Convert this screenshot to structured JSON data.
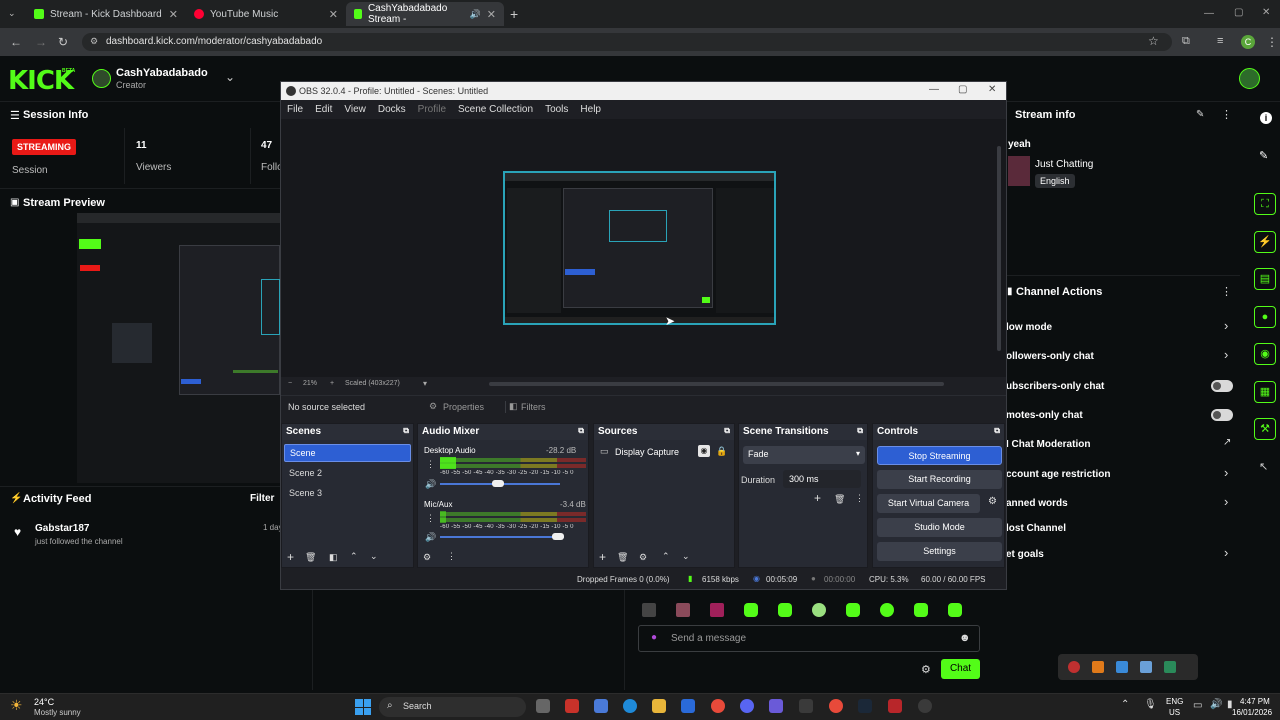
{
  "browser": {
    "tabs": [
      {
        "title": "Stream - Kick Dashboard"
      },
      {
        "title": "YouTube Music"
      },
      {
        "title": "CashYabadabado Stream -"
      }
    ],
    "url": "dashboard.kick.com/moderator/cashyabadabado",
    "profile_initial": "C"
  },
  "kick": {
    "logo": "KICK",
    "logo_tag": "BETA",
    "channel_name": "CashYabadabado",
    "channel_role": "Creator",
    "session_info": {
      "title": "Session Info",
      "status": "STREAMING",
      "status_label": "Session",
      "viewers_value": "11",
      "viewers_label": "Viewers",
      "followers_value": "47",
      "followers_label": "Follo"
    },
    "stream_preview_title": "Stream Preview",
    "activity_feed": {
      "title": "Activity Feed",
      "filter": "Filter",
      "items": [
        {
          "user": "Gabstar187",
          "text": "just followed the channel",
          "time": "1 day"
        }
      ]
    },
    "stream_info": {
      "title": "Stream info",
      "stream_title": "yeah",
      "category": "Just Chatting",
      "language": "English"
    },
    "channel_actions": {
      "title": "Channel Actions",
      "items": [
        {
          "label": "low mode",
          "control": "chevron"
        },
        {
          "label": "ollowers-only chat",
          "control": "chevron"
        },
        {
          "label": "ubscribers-only chat",
          "control": "toggle"
        },
        {
          "label": "motes-only chat",
          "control": "toggle"
        },
        {
          "label": "I Chat Moderation",
          "control": "external"
        },
        {
          "label": "ccount age restriction",
          "control": "chevron"
        },
        {
          "label": "anned words",
          "control": "chevron"
        },
        {
          "label": "lost Channel",
          "control": "none"
        },
        {
          "label": "et goals",
          "control": "chevron"
        }
      ]
    },
    "chat": {
      "placeholder": "Send a message",
      "send_label": "Chat"
    }
  },
  "obs": {
    "title": "OBS 32.0.4 - Profile: Untitled - Scenes: Untitled",
    "menu": [
      "File",
      "Edit",
      "View",
      "Docks",
      "Profile",
      "Scene Collection",
      "Tools",
      "Help"
    ],
    "zoom": "21%",
    "scale_label": "Scaled (403x227)",
    "no_source": "No source selected",
    "properties_label": "Properties",
    "filters_label": "Filters",
    "scenes": {
      "title": "Scenes",
      "items": [
        "Scene",
        "Scene 2",
        "Scene 3"
      ]
    },
    "audio_mixer": {
      "title": "Audio Mixer",
      "channels": [
        {
          "name": "Desktop Audio",
          "db": "-28.2 dB",
          "level": 0.55
        },
        {
          "name": "Mic/Aux",
          "db": "-3.4 dB",
          "level": 0.85
        }
      ],
      "ticks": "-60 -55 -50 -45 -40 -35 -30 -25 -20 -15 -10 -5 0"
    },
    "sources": {
      "title": "Sources",
      "items": [
        "Display Capture"
      ]
    },
    "transitions": {
      "title": "Scene Transitions",
      "selected": "Fade",
      "duration_label": "Duration",
      "duration": "300 ms"
    },
    "controls": {
      "title": "Controls",
      "stop_streaming": "Stop Streaming",
      "start_recording": "Start Recording",
      "virtual_camera": "Start Virtual Camera",
      "studio_mode": "Studio Mode",
      "settings": "Settings"
    },
    "status": {
      "dropped": "Dropped Frames 0 (0.0%)",
      "bitrate": "6158 kbps",
      "stream_time": "00:05:09",
      "rec_time": "00:00:00",
      "cpu": "CPU: 5.3%",
      "fps": "60.00 / 60.00 FPS"
    }
  },
  "taskbar": {
    "weather_temp": "24°C",
    "weather_desc": "Mostly sunny",
    "search": "Search",
    "lang": "ENG",
    "region": "US",
    "time": "4:47 PM",
    "date": "16/01/2026"
  },
  "colors": {
    "kick_green": "#53fc18",
    "obs_blue": "#2d5fd3",
    "streaming_red": "#e91916"
  }
}
